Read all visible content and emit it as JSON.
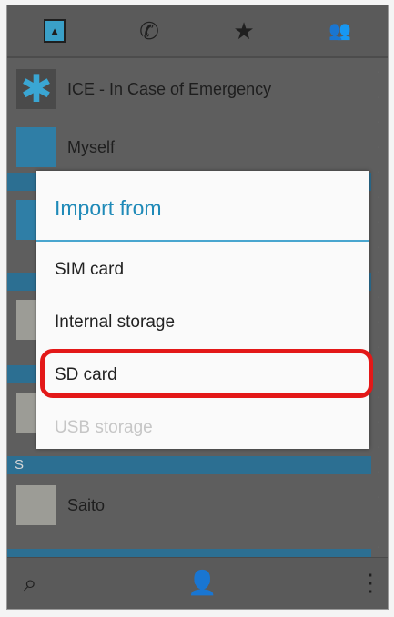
{
  "tabs": [
    "contacts",
    "call log",
    "favorites",
    "groups"
  ],
  "contacts": [
    {
      "name": "ICE - In Case of Emergency",
      "avatar": "medical-star-icon"
    },
    {
      "name": "Myself",
      "avatar": "person-icon"
    },
    {
      "name": "Saito",
      "avatar": "photo"
    }
  ],
  "section_letter": "S",
  "dialog": {
    "title": "Import from",
    "options": [
      "SIM card",
      "Internal storage",
      "SD card",
      "USB storage"
    ]
  },
  "highlight_color": "#e31818",
  "accent_color": "#1f8ab8"
}
